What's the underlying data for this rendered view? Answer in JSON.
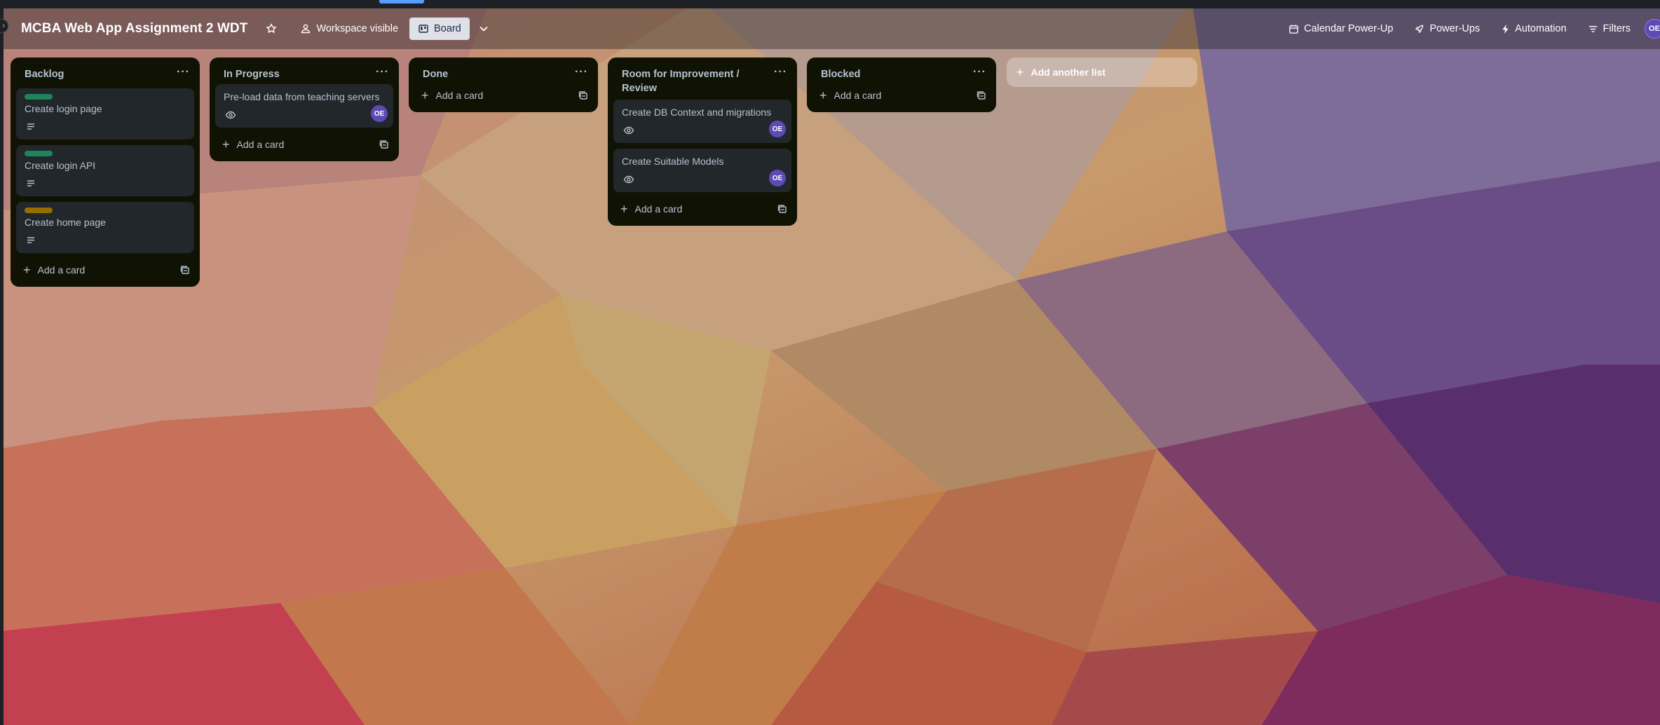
{
  "header": {
    "board_title": "MCBA Web App Assignment 2 WDT",
    "visibility": "Workspace visible",
    "view": "Board",
    "calendar": "Calendar Power-Up",
    "powerups": "Power-Ups",
    "automation": "Automation",
    "filters": "Filters",
    "user_initials": "OE"
  },
  "lists": [
    {
      "title": "Backlog",
      "cards": [
        {
          "title": "Create login page",
          "label_color": "#1f845a",
          "description_icon": "description-icon"
        },
        {
          "title": "Create login API",
          "label_color": "#1f845a",
          "description_icon": "description-icon"
        },
        {
          "title": "Create home page",
          "label_color": "#946f00",
          "description_icon": "description-icon"
        }
      ],
      "add_card": "Add a card"
    },
    {
      "title": "In Progress",
      "cards": [
        {
          "title": "Pre-load data from teaching servers",
          "watch_icon": "eye-icon",
          "member": "OE"
        }
      ],
      "add_card": "Add a card"
    },
    {
      "title": "Done",
      "cards": [],
      "add_card": "Add a card"
    },
    {
      "title": "Room for Improvement / Review",
      "cards": [
        {
          "title": "Create DB Context and migrations",
          "watch_icon": "eye-icon",
          "member": "OE"
        },
        {
          "title": "Create Suitable Models",
          "watch_icon": "eye-icon",
          "member": "OE"
        }
      ],
      "add_card": "Add a card"
    },
    {
      "title": "Blocked",
      "cards": [],
      "add_card": "Add a card"
    }
  ],
  "add_list": "Add another list",
  "colors": {
    "list_bg": "#101204",
    "card_bg": "#22272b",
    "text": "#b6c2cf",
    "member_avatar": "#5d4ab5",
    "label_green": "#1f845a",
    "label_yellow": "#946f00"
  }
}
